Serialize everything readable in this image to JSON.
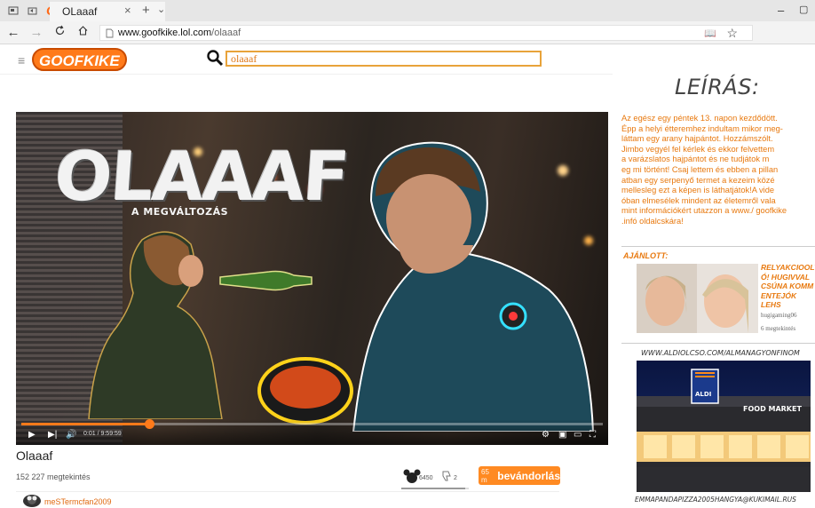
{
  "browser": {
    "tab_title": "OLaaaf",
    "tab_close": "×",
    "new_tab": "+",
    "tab_menu": "⌄",
    "logo_text": "GF",
    "url_host": "www.goofkike.lol.com",
    "url_path": "/olaaaf",
    "win_min": "–",
    "win_max": "▢"
  },
  "site": {
    "logo": "GOOFKIKE",
    "search_value": "olaaaf"
  },
  "video": {
    "overlay_title": "OLAAAF",
    "overlay_subtitle": "A MEGVÁLTOZÁS",
    "current_time": "0:01 / 9:59:59",
    "progress": 0.22,
    "title": "Olaaaf",
    "views": "152 227 megtekintés",
    "likes": "6450",
    "dislikes": "2",
    "like_ratio": 0.95,
    "subscribe_count": "65 m",
    "subscribe_label": "bevándorlás",
    "comment_user": "meSTermcfan2009"
  },
  "sidebar": {
    "desc_heading": "LEÍRÁS:",
    "desc_text": "Az egész egy péntek 13. napon kezdődött.\nÉpp a helyi étteremhez indultam mikor meg-\nláttam egy arany hajpántot. Hozzámszólt.\nJimbo vegyél fel kérlek és ekkor felvettem\n a varázslatos hajpántot és ne tudjátok m\neg mi történt! Csaj lettem és ebben a pillan\natban egy serpenyő termet a kezeim közé\nmellesleg ezt a képen is láthatjátok!A vide\nóban elmesélek mindent az életemről vala\nmint információkért utazzon a www./ goofkike\n.infó oldalcskára!",
    "rec_label": "AJÁNLOTT:",
    "rec_title": "RELYAKCIOOLY\nÓ! HUGIVVAL\nCSÚNA KOMM\nENTEJÓK LEHS",
    "rec_channel": "hugigaming06",
    "rec_views": "6 megtekintés",
    "ad_url": "WWW.ALDIOLCSO.COM/ALMANAGYONFINOM",
    "ad_store_name": "FOOD MARKET",
    "ad_brand": "ALDI",
    "ad_email": "EMMAPANDAPIZZA2005HANGYA@KUKIMAIL.RUS"
  },
  "colors": {
    "accent": "#e8790f",
    "brand": "#ff7a1a"
  }
}
